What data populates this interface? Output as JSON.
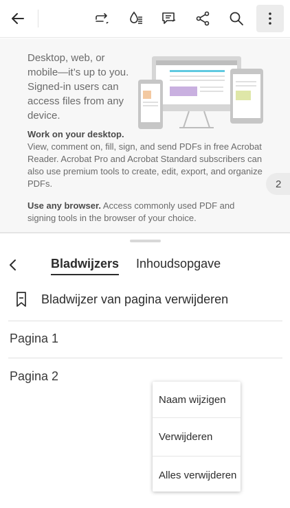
{
  "toolbar": {
    "back": "back-arrow-icon",
    "actions": [
      "redo-share-icon",
      "fill-sign-icon",
      "comment-icon",
      "share-icon",
      "search-icon",
      "more-vertical-icon"
    ]
  },
  "document": {
    "lead": "Desktop, web, or mobile—it’s up to you. Signed-in users can access files from any device.",
    "section1_heading": "Work on your desktop.",
    "section1_body": "View, comment on, fill, sign, and send PDFs in free Acrobat Reader. Acrobat Pro and Acrobat Standard subscribers can also use premium tools to create, edit, export, and organize PDFs.",
    "section2_heading": "Use any browser.",
    "section2_body": "Access commonly used PDF and signing tools in the browser of your choice.",
    "page_number": "2"
  },
  "panel": {
    "tabs": [
      {
        "label": "Bladwijzers",
        "active": true
      },
      {
        "label": "Inhoudsopgave",
        "active": false
      }
    ],
    "remove_bookmark_label": "Bladwijzer van pagina verwijderen",
    "bookmarks": [
      "Pagina 1",
      "Pagina 2"
    ]
  },
  "context_menu": {
    "items": [
      "Naam wijzigen",
      "Verwijderen",
      "Alles verwijderen"
    ]
  },
  "colors": {
    "accent": "#2c2c2c",
    "doc_bg": "#f7f7f7",
    "illus_green": "#dfe7a8",
    "illus_purple": "#c9b0e0",
    "illus_cyan": "#5fc9e0",
    "illus_orange": "#f3c9a1"
  }
}
